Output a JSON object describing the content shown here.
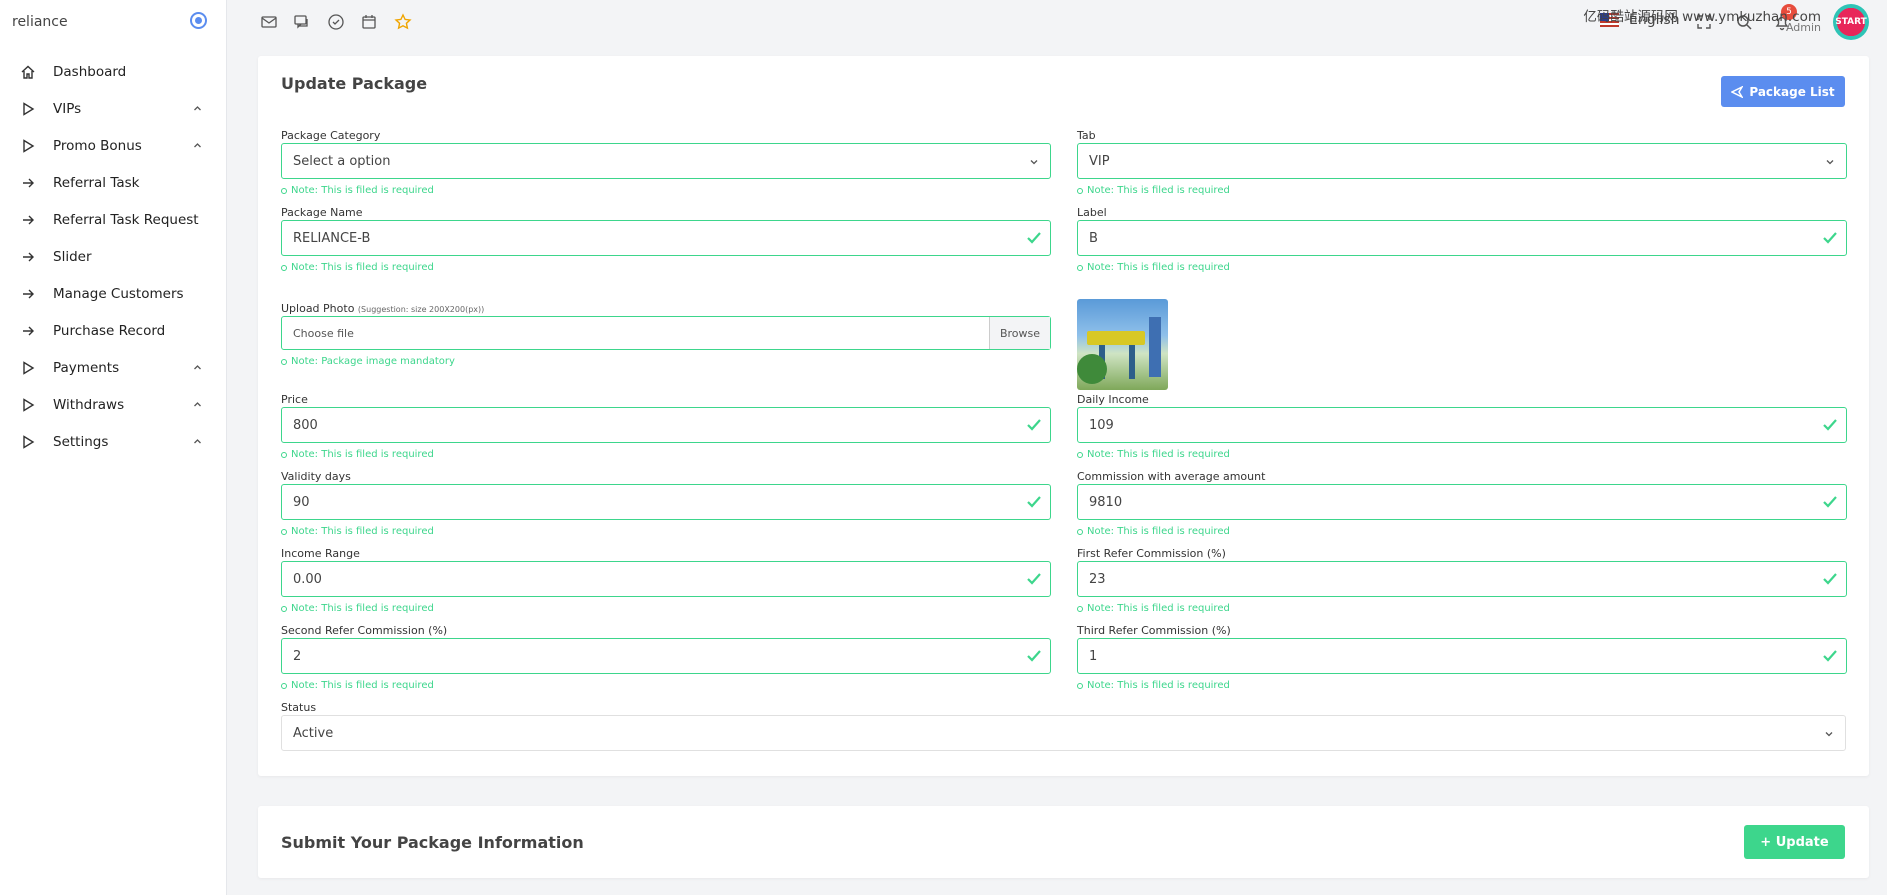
{
  "brand": {
    "name": "reliance"
  },
  "sidebar": {
    "items": [
      {
        "label": "Dashboard",
        "icon": "home-icon",
        "chevron": false
      },
      {
        "label": "VIPs",
        "icon": "play-icon",
        "chevron": true
      },
      {
        "label": "Promo Bonus",
        "icon": "play-icon",
        "chevron": true
      },
      {
        "label": "Referral Task",
        "icon": "arrow-right-icon",
        "chevron": false
      },
      {
        "label": "Referral Task Request",
        "icon": "arrow-right-icon",
        "chevron": false
      },
      {
        "label": "Slider",
        "icon": "arrow-right-icon",
        "chevron": false
      },
      {
        "label": "Manage Customers",
        "icon": "arrow-right-icon",
        "chevron": false
      },
      {
        "label": "Purchase Record",
        "icon": "arrow-right-icon",
        "chevron": false
      },
      {
        "label": "Payments",
        "icon": "play-icon",
        "chevron": true
      },
      {
        "label": "Withdraws",
        "icon": "play-icon",
        "chevron": true
      },
      {
        "label": "Settings",
        "icon": "play-icon",
        "chevron": true
      }
    ]
  },
  "topbar": {
    "language": "English",
    "notification_count": "5",
    "user_name": "亿码酷站源码网 www.ymkuzhan.com",
    "user_role": "Admin",
    "avatar_text": "START"
  },
  "colors": {
    "accent_green": "#3dd68c",
    "accent_blue": "#5b8def",
    "badge_red": "#e74c3c"
  },
  "form": {
    "title": "Update Package",
    "list_button": "Package List",
    "required_note": "Note: This is filed is required",
    "package_category": {
      "label": "Package Category",
      "value": "Select a option"
    },
    "tab": {
      "label": "Tab",
      "value": "VIP"
    },
    "package_name": {
      "label": "Package Name",
      "value": "RELIANCE-B"
    },
    "label_field": {
      "label": "Label",
      "value": "B"
    },
    "upload": {
      "label": "Upload Photo",
      "hint": "(Suggestion: size 200X200(px))",
      "placeholder": "Choose file",
      "browse": "Browse",
      "note": "Note: Package image mandatory"
    },
    "price": {
      "label": "Price",
      "value": "800"
    },
    "daily_income": {
      "label": "Daily Income",
      "value": "109"
    },
    "validity_days": {
      "label": "Validity days",
      "value": "90"
    },
    "commission_avg": {
      "label": "Commission with average amount",
      "value": "9810"
    },
    "income_range": {
      "label": "Income Range",
      "value": "0.00"
    },
    "first_refer": {
      "label": "First Refer Commission (%)",
      "value": "23"
    },
    "second_refer": {
      "label": "Second Refer Commission (%)",
      "value": "2"
    },
    "third_refer": {
      "label": "Third Refer Commission (%)",
      "value": "1"
    },
    "status": {
      "label": "Status",
      "value": "Active"
    }
  },
  "footer": {
    "title": "Submit Your Package Information",
    "update_button": "+ Update"
  }
}
